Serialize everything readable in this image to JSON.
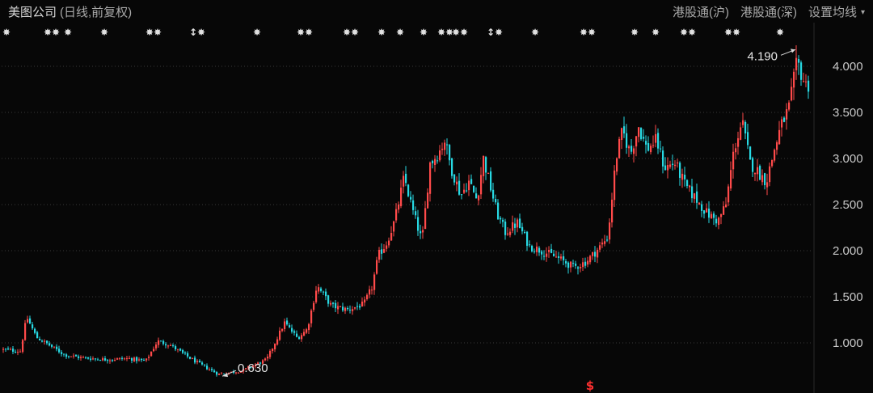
{
  "header": {
    "stock_name": "美图公司",
    "period_label": "(日线,前复权)",
    "hk_connect_sh": "港股通(沪)",
    "hk_connect_sz": "港股通(深)",
    "settings_label": "设置均线",
    "settings_caret": "▾"
  },
  "colors": {
    "up": "#ff4a4a",
    "down": "#27d9e3",
    "grid": "#3a3a3a",
    "background": "#070707"
  },
  "chart_data": {
    "type": "candlestick",
    "title": "",
    "ylim": [
      0.55,
      4.3
    ],
    "y_ticks": [
      1.0,
      1.5,
      2.0,
      2.5,
      3.0,
      3.5,
      4.0
    ],
    "y_tick_labels": [
      "1.000",
      "1.500",
      "2.000",
      "2.500",
      "3.000",
      "3.500",
      "4.000"
    ],
    "grid": true,
    "close_anchors": [
      [
        0,
        0.93
      ],
      [
        25,
        0.91
      ],
      [
        33,
        1.28
      ],
      [
        45,
        1.06
      ],
      [
        60,
        0.98
      ],
      [
        80,
        0.87
      ],
      [
        100,
        0.84
      ],
      [
        130,
        0.82
      ],
      [
        160,
        0.83
      ],
      [
        180,
        0.8
      ],
      [
        195,
        1.02
      ],
      [
        210,
        0.98
      ],
      [
        225,
        0.89
      ],
      [
        245,
        0.78
      ],
      [
        270,
        0.66
      ],
      [
        300,
        0.7
      ],
      [
        330,
        0.82
      ],
      [
        352,
        1.22
      ],
      [
        368,
        1.05
      ],
      [
        380,
        1.15
      ],
      [
        392,
        1.62
      ],
      [
        410,
        1.4
      ],
      [
        430,
        1.36
      ],
      [
        450,
        1.42
      ],
      [
        460,
        1.6
      ],
      [
        468,
        1.95
      ],
      [
        478,
        2.08
      ],
      [
        488,
        2.32
      ],
      [
        500,
        2.8
      ],
      [
        510,
        2.45
      ],
      [
        522,
        2.1
      ],
      [
        532,
        2.95
      ],
      [
        542,
        3.05
      ],
      [
        550,
        3.2
      ],
      [
        558,
        2.9
      ],
      [
        570,
        2.6
      ],
      [
        580,
        2.75
      ],
      [
        590,
        2.55
      ],
      [
        598,
        3.0
      ],
      [
        605,
        2.75
      ],
      [
        615,
        2.4
      ],
      [
        625,
        2.2
      ],
      [
        640,
        2.3
      ],
      [
        655,
        2.05
      ],
      [
        670,
        2.0
      ],
      [
        690,
        1.92
      ],
      [
        710,
        1.82
      ],
      [
        725,
        1.88
      ],
      [
        740,
        2.02
      ],
      [
        752,
        2.15
      ],
      [
        762,
        3.0
      ],
      [
        770,
        3.3
      ],
      [
        780,
        3.05
      ],
      [
        790,
        3.35
      ],
      [
        800,
        3.1
      ],
      [
        812,
        3.2
      ],
      [
        822,
        2.9
      ],
      [
        835,
        2.95
      ],
      [
        848,
        2.7
      ],
      [
        862,
        2.55
      ],
      [
        875,
        2.4
      ],
      [
        888,
        2.32
      ],
      [
        898,
        2.5
      ],
      [
        908,
        3.1
      ],
      [
        918,
        3.4
      ],
      [
        928,
        2.95
      ],
      [
        938,
        2.85
      ],
      [
        948,
        2.75
      ],
      [
        958,
        3.1
      ],
      [
        966,
        3.35
      ],
      [
        976,
        3.55
      ],
      [
        986,
        4.05
      ],
      [
        996,
        3.8
      ]
    ],
    "annotations": [
      {
        "label": "4.190",
        "value": 4.19,
        "type": "max"
      },
      {
        "label": "0.630",
        "value": 0.63,
        "type": "min"
      }
    ],
    "event_markers": [
      "✸",
      "✸✸",
      "✸",
      "✸",
      "✸✸",
      "↕✸",
      "✸",
      "✸✸",
      "✸✸",
      "✸",
      "✸",
      "✸",
      "✸✸",
      "✸✸",
      "↕✸",
      "✸",
      "✸✸",
      "✸",
      "✸",
      "✸✸",
      "✸✸",
      "✸"
    ],
    "dividend_marker": "$"
  }
}
